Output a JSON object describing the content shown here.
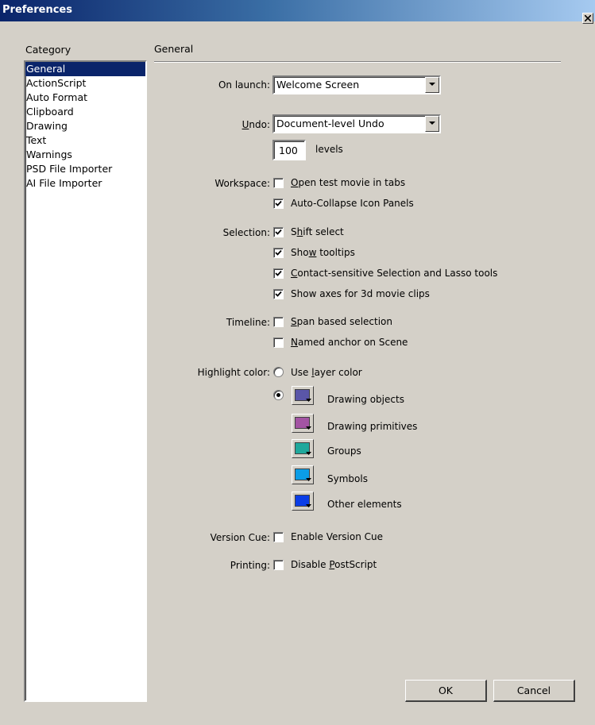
{
  "window": {
    "title": "Preferences"
  },
  "category": {
    "header": "Category",
    "items": [
      "General",
      "ActionScript",
      "Auto Format",
      "Clipboard",
      "Drawing",
      "Text",
      "Warnings",
      "PSD File Importer",
      "AI File Importer"
    ],
    "selected": "General"
  },
  "panel": {
    "title": "General"
  },
  "on_launch": {
    "label": "On launch:",
    "value": "Welcome Screen"
  },
  "undo": {
    "label_pre": "",
    "label_u": "U",
    "label_post": "ndo:",
    "value": "Document-level Undo",
    "levels_value": "100",
    "levels_label": "levels"
  },
  "workspace": {
    "label": "Workspace:",
    "open_tabs": {
      "pre": "",
      "u": "O",
      "post": "pen test movie in tabs",
      "checked": false
    },
    "auto_collapse": {
      "label": "Auto-Collapse Icon Panels",
      "checked": true
    }
  },
  "selection": {
    "label": "Selection:",
    "shift_select": {
      "pre": "S",
      "u": "h",
      "post": "ift select",
      "checked": true
    },
    "show_tooltips": {
      "pre": "Sho",
      "u": "w",
      "post": " tooltips",
      "checked": true
    },
    "contact_sensitive": {
      "pre": "",
      "u": "C",
      "post": "ontact-sensitive Selection and Lasso tools",
      "checked": true
    },
    "show_axes": {
      "label": "Show axes for 3d movie clips",
      "checked": true
    }
  },
  "timeline": {
    "label": "Timeline:",
    "span_based": {
      "pre": "",
      "u": "S",
      "post": "pan based selection",
      "checked": false
    },
    "named_anchor": {
      "pre": "",
      "u": "N",
      "post": "amed anchor on Scene",
      "checked": false
    }
  },
  "highlight": {
    "label": "Highlight color:",
    "use_layer": {
      "pre": "Use ",
      "u": "l",
      "post": "ayer color",
      "selected": false
    },
    "custom_selected": true,
    "colors": [
      {
        "label": "Drawing objects",
        "color": "#5a56a8"
      },
      {
        "label": "Drawing primitives",
        "color": "#a354a3"
      },
      {
        "label": "Groups",
        "color": "#1fa89c"
      },
      {
        "label": "Symbols",
        "color": "#0b9de6"
      },
      {
        "label": "Other elements",
        "color": "#0a3de6"
      }
    ]
  },
  "version_cue": {
    "label": "Version Cue:",
    "option": "Enable Version Cue",
    "checked": false
  },
  "printing": {
    "label": "Printing:",
    "pre": "Disable ",
    "u": "P",
    "post": "ostScript",
    "checked": false
  },
  "buttons": {
    "ok": "OK",
    "cancel": "Cancel"
  }
}
